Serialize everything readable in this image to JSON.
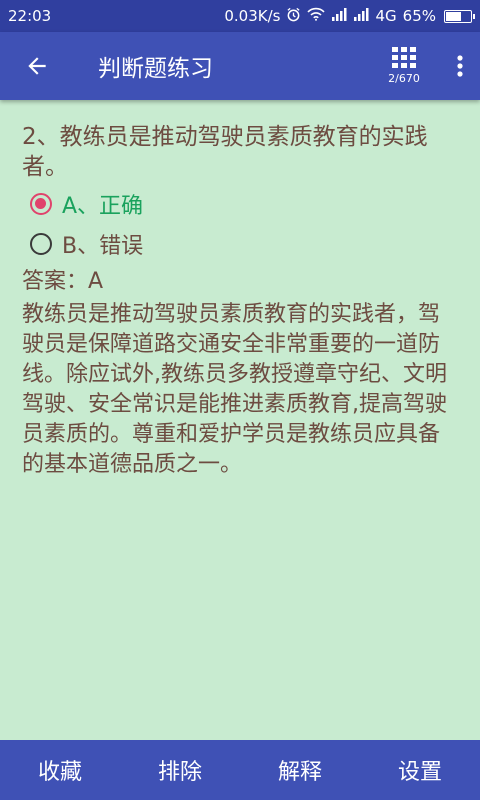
{
  "status_bar": {
    "time": "22:03",
    "speed": "0.03K/s",
    "network": "4G",
    "battery": "65%",
    "battery_level": 0.65
  },
  "toolbar": {
    "title": "判断题练习",
    "progress": "2/670"
  },
  "question": {
    "text": "2、教练员是推动驾驶员素质教育的实践者。",
    "options": [
      {
        "label": "A、正确",
        "selected": true
      },
      {
        "label": "B、错误",
        "selected": false
      }
    ],
    "answer": "答案：A",
    "explanation": "教练员是推动驾驶员素质教育的实践者，驾驶员是保障道路交通安全非常重要的一道防线。除应试外,教练员多教授遵章守纪、文明驾驶、安全常识是能推进素质教育,提高驾驶员素质的。尊重和爱护学员是教练员应具备的基本道德品质之一。"
  },
  "bottom_bar": {
    "favorite": "收藏",
    "exclude": "排除",
    "explain": "解释",
    "settings": "设置"
  },
  "colors": {
    "primary": "#3f51b5",
    "primary_dark": "#303f9f",
    "background": "#c8ebd0",
    "text": "#6d4c41",
    "correct": "#1aa25d",
    "radio_selected": "#e0436c"
  }
}
